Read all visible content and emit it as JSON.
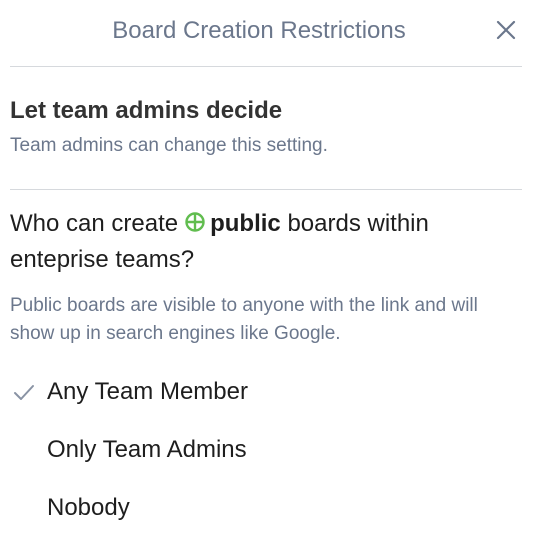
{
  "header": {
    "title": "Board Creation Restrictions"
  },
  "team_admin_option": {
    "title": "Let team admins decide",
    "description": "Team admins can change this setting."
  },
  "question": {
    "prefix": "Who can create",
    "emphasis": "public",
    "suffix": "boards within enteprise teams?"
  },
  "note": "Public boards are visible to anyone with the link and will show up in search engines like Google.",
  "choices": [
    {
      "label": "Any Team Member",
      "selected": true
    },
    {
      "label": "Only Team Admins",
      "selected": false
    },
    {
      "label": "Nobody",
      "selected": false
    }
  ],
  "colors": {
    "globe": "#61bd4f",
    "muted_text": "#6b778c",
    "check": "#8993a4"
  }
}
